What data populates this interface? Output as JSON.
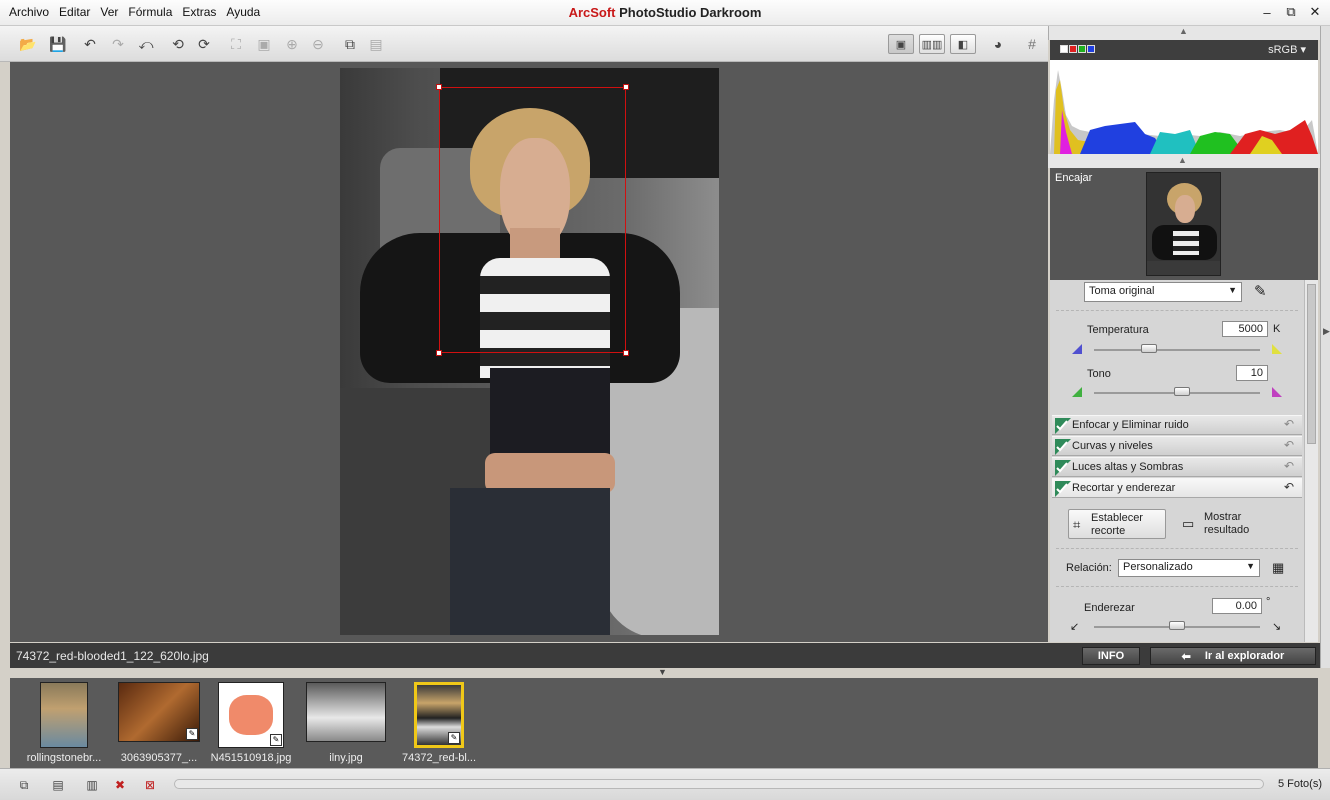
{
  "menu": [
    "Archivo",
    "Editar",
    "Ver",
    "Fórmula",
    "Extras",
    "Ayuda"
  ],
  "app": {
    "brand": "ArcSoft",
    "product": "PhotoStudio Darkroom"
  },
  "window_controls": {
    "minimize": "–",
    "restore": "⧉",
    "close": "✕"
  },
  "toolbar": {
    "icons": [
      "open-icon",
      "save-icon",
      "undo-icon",
      "redo-icon",
      "revert-icon",
      "rotate-left-icon",
      "rotate-right-icon",
      "fit-icon",
      "actual-size-icon",
      "zoom-in-icon",
      "zoom-out-icon",
      "copy-icon",
      "paste-icon",
      "single-view-icon",
      "compare-view-icon",
      "split-view-icon",
      "color-wheel-icon",
      "grid-icon"
    ]
  },
  "status": {
    "filename": "74372_red-blooded1_122_620lo.jpg"
  },
  "buttons": {
    "info": "INFO",
    "explore": "Ir al explorador"
  },
  "histogram": {
    "colorspace": "sRGB ▾",
    "swatch_colors": [
      "#ffffff",
      "#e02020",
      "#20b020",
      "#2040e0"
    ]
  },
  "navigator": {
    "label": "Encajar"
  },
  "adjust": {
    "preset": "Toma original",
    "temperature": {
      "label": "Temperatura",
      "value": "5000",
      "unit": "K",
      "level": 0.33
    },
    "tint": {
      "label": "Tono",
      "value": "10",
      "level": 0.53
    },
    "sections": [
      "Enfocar y Eliminar ruido",
      "Curvas y niveles",
      "Luces altas y Sombras",
      "Recortar y enderezar"
    ],
    "crop_set": "Establecer recorte",
    "crop_show": "Mostrar resultado",
    "ratio_label": "Relación:",
    "ratio_value": "Personalizado",
    "straighten": {
      "label": "Enderezar",
      "value": "0.00",
      "unit": "°",
      "level": 0.5
    }
  },
  "filmstrip": [
    {
      "name": "rollingstonebr...",
      "edited": false,
      "selected": false
    },
    {
      "name": "3063905377_...",
      "edited": true,
      "selected": false
    },
    {
      "name": "N451510918.jpg",
      "edited": true,
      "selected": false
    },
    {
      "name": "ilny.jpg",
      "edited": false,
      "selected": false
    },
    {
      "name": "74372_red-bl...",
      "edited": true,
      "selected": true
    }
  ],
  "bottom": {
    "count": "5 Foto(s)"
  }
}
